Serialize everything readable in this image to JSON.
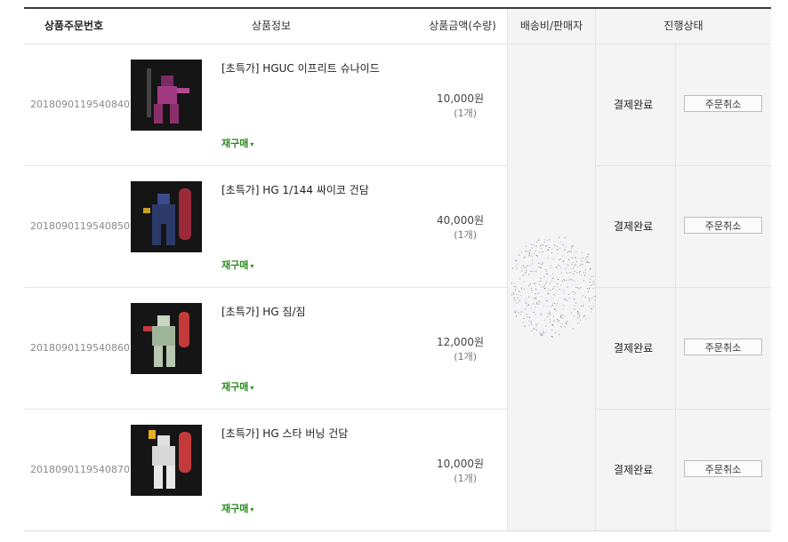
{
  "headers": {
    "order_no": "상품주문번호",
    "product_info": "상품정보",
    "amount": "상품금액(수량)",
    "shipping": "배송비/판매자",
    "status": "진행상태"
  },
  "rows": [
    {
      "order_no": "2018090119540840",
      "name": "[초특가] HGUC 이프리트 슈나이드",
      "price": "10,000원",
      "qty": "(1개)",
      "rebuy": "재구매",
      "status": "결제완료",
      "cancel": "주문취소",
      "thumb_color": "#8a2f6a"
    },
    {
      "order_no": "2018090119540850",
      "name": "[초특가] HG 1/144 싸이코 건담",
      "price": "40,000원",
      "qty": "(1개)",
      "rebuy": "재구매",
      "status": "결제완료",
      "cancel": "주문취소",
      "thumb_color": "#2c3a6a"
    },
    {
      "order_no": "2018090119540860",
      "name": "[초특가] HG 짐/짐",
      "price": "12,000원",
      "qty": "(1개)",
      "rebuy": "재구매",
      "status": "결제완료",
      "cancel": "주문취소",
      "thumb_color": "#9fb59a"
    },
    {
      "order_no": "2018090119540870",
      "name": "[초특가] HG 스타 버닝 건담",
      "price": "10,000원",
      "qty": "(1개)",
      "rebuy": "재구매",
      "status": "결제완료",
      "cancel": "주문취소",
      "thumb_color": "#c43a3a"
    }
  ],
  "colors": {
    "rebuy": "#2a8a1f",
    "header_line": "#3a3a3a",
    "gray_col": "#f4f4f4"
  },
  "icons": {
    "rebuy_chevron": "chevron-down-icon"
  }
}
